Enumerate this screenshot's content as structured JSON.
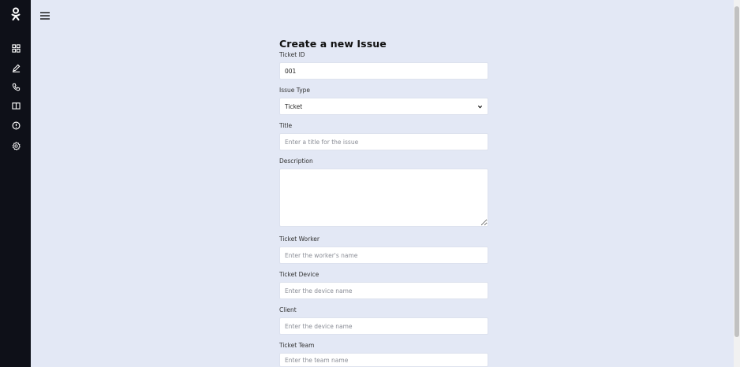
{
  "sidebar": {
    "logo": "odnoklassniki-logo-icon",
    "items": [
      {
        "icon": "dashboard-grid-icon"
      },
      {
        "icon": "pencil-icon"
      },
      {
        "icon": "phone-icon"
      },
      {
        "icon": "book-icon"
      },
      {
        "icon": "info-circle-icon"
      },
      {
        "icon": "settings-gear-icon"
      }
    ]
  },
  "topbar": {
    "menu_icon": "hamburger-menu-icon"
  },
  "form": {
    "title": "Create a new Issue",
    "ticket_id": {
      "label": "Ticket ID",
      "value": "001"
    },
    "issue_type": {
      "label": "Issue Type",
      "value": "Ticket"
    },
    "title_field": {
      "label": "Title",
      "placeholder": "Enter a title for the issue"
    },
    "description": {
      "label": "Description",
      "placeholder": ""
    },
    "worker": {
      "label": "Ticket Worker",
      "placeholder": "Enter the worker's name"
    },
    "device": {
      "label": "Ticket Device",
      "placeholder": "Enter the device name"
    },
    "client": {
      "label": "Client",
      "placeholder": "Enter the device name"
    },
    "team": {
      "label": "Ticket Team",
      "placeholder": "Enter the team name"
    }
  },
  "colors": {
    "sidebar_bg": "#0e1018",
    "page_bg": "#e3e8f5",
    "field_bg": "#ffffff"
  }
}
